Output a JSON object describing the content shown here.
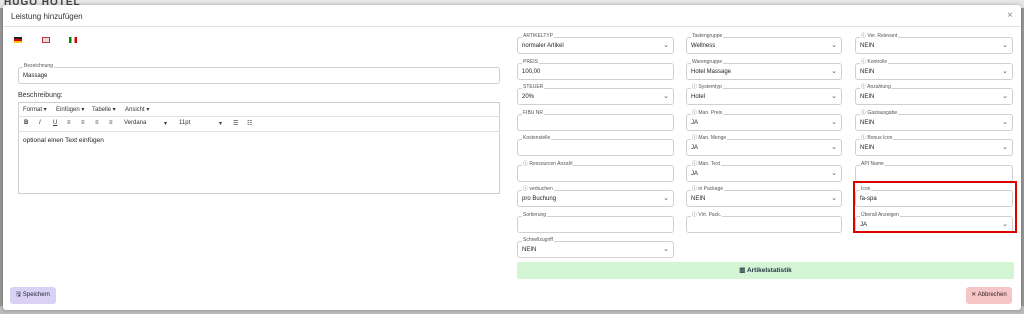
{
  "background": {
    "logo_text": "HUGO HOTEL"
  },
  "modal": {
    "title": "Leistung hinzufügen",
    "close_label": "×"
  },
  "left": {
    "bezeichnung": {
      "label": "Bezeichnung",
      "value": "Massage"
    },
    "beschreibung_label": "Beschreibung:",
    "editor": {
      "menu": [
        "Format ▾",
        "Einfügen ▾",
        "Tabelle ▾",
        "Ansicht ▾"
      ],
      "toolbar": [
        "B",
        "I",
        "U",
        "≡",
        "≡",
        "≡",
        "≡",
        "Verdana",
        "▾",
        "11pt",
        "▾",
        "☰",
        "☷"
      ],
      "text": "optional einen Text einfügen"
    }
  },
  "col1": [
    {
      "label": "ARTIKELTYP",
      "value": "normaler Artikel",
      "chev": "⌄"
    },
    {
      "label": "PREIS",
      "value": "100,00",
      "chev": ""
    },
    {
      "label": "STEUER",
      "value": "20%",
      "chev": "⌄"
    },
    {
      "label": "FIBU NR",
      "value": "",
      "chev": ""
    },
    {
      "label": "Kostenstelle",
      "value": "",
      "chev": ""
    },
    {
      "label": "ⓘ Ressourcen Anzahl",
      "value": "",
      "chev": ""
    },
    {
      "label": "ⓘ verbuchen",
      "value": "pro Buchung",
      "chev": "⌄"
    },
    {
      "label": "Sortierung",
      "value": "",
      "chev": ""
    },
    {
      "label": "Schnellzugriff",
      "value": "NEIN",
      "chev": "⌄"
    }
  ],
  "col2": [
    {
      "label": "Tastengruppe",
      "value": "Wellness",
      "chev": "⌄"
    },
    {
      "label": "Warengruppe",
      "value": "Hotel Massage",
      "chev": "⌄"
    },
    {
      "label": "ⓘ Systemtyp",
      "value": "Hotel",
      "chev": "⌄"
    },
    {
      "label": "ⓘ Man. Preis",
      "value": "JA",
      "chev": "⌄"
    },
    {
      "label": "ⓘ Man. Menge",
      "value": "JA",
      "chev": "⌄"
    },
    {
      "label": "ⓘ Man. Text",
      "value": "JA",
      "chev": "⌄"
    },
    {
      "label": "ⓘ in Package",
      "value": "NEIN",
      "chev": "⌄"
    },
    {
      "label": "ⓘ Virt. Pack.",
      "value": "",
      "chev": ""
    }
  ],
  "col3": [
    {
      "label": "ⓘ Ver. Relevant",
      "value": "NEIN",
      "chev": "⌄"
    },
    {
      "label": "ⓘ Kontrolle",
      "value": "NEIN",
      "chev": "⌄"
    },
    {
      "label": "ⓘ Anzahlung",
      "value": "NEIN",
      "chev": "⌄"
    },
    {
      "label": "ⓘ Gastausgabe",
      "value": "NEIN",
      "chev": "⌄"
    },
    {
      "label": "ⓘ Bonus Icon",
      "value": "NEIN",
      "chev": "⌄"
    },
    {
      "label": "API Name",
      "value": "",
      "chev": ""
    },
    {
      "label": "Icon",
      "value": "fa-spa",
      "chev": ""
    },
    {
      "label": "Überall Anzeigen",
      "value": "JA",
      "chev": "⌄"
    }
  ],
  "buttons": {
    "statistik": "▥ Artikelstatistik",
    "save": "🖫 Speichern",
    "cancel": "✕ Abbrechen"
  }
}
